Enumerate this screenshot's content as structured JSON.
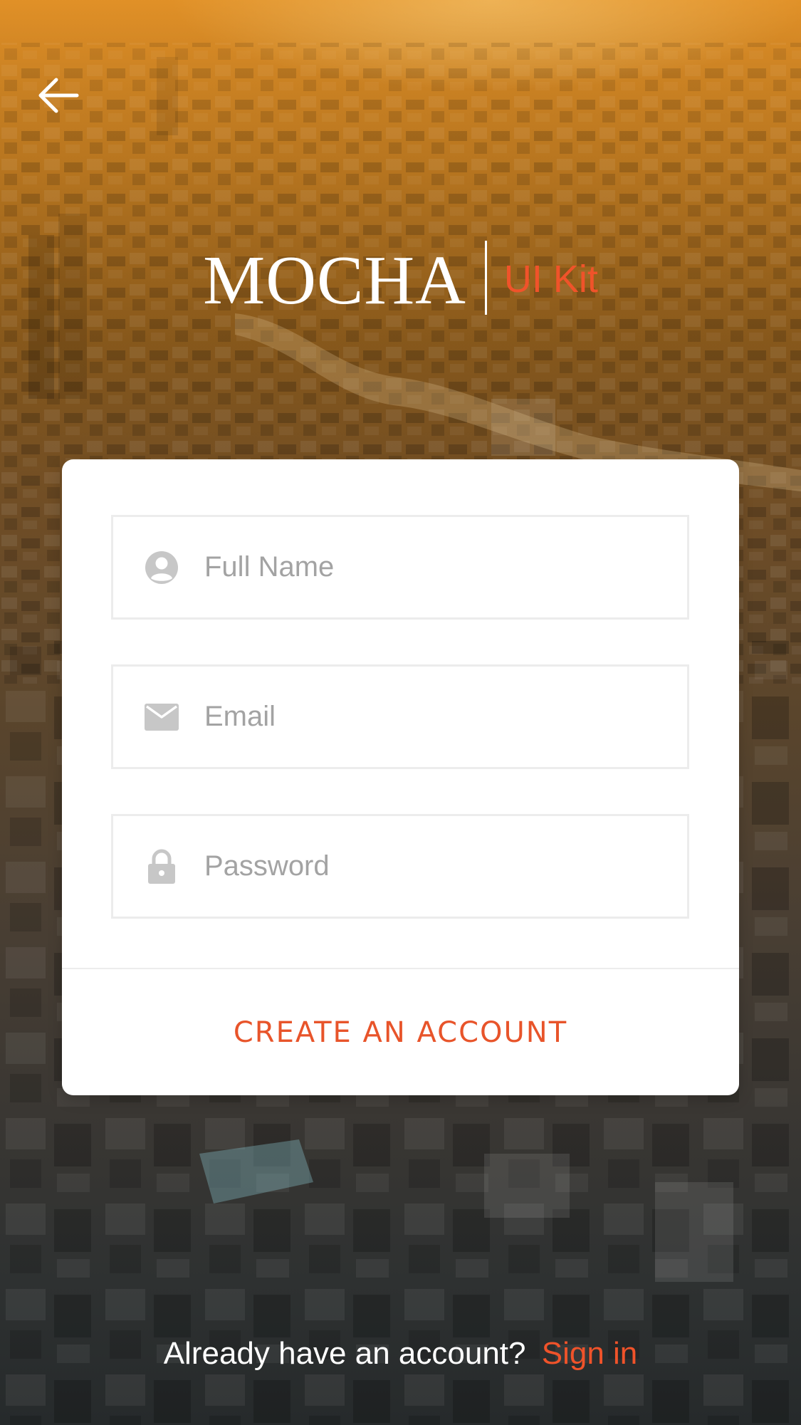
{
  "brand": {
    "name": "MOCHA",
    "subtitle": "UI Kit",
    "accent_color": "#f0532a"
  },
  "nav": {
    "back_icon": "arrow-left-icon"
  },
  "form": {
    "full_name": {
      "placeholder": "Full Name",
      "value": "",
      "icon": "user-icon"
    },
    "email": {
      "placeholder": "Email",
      "value": "",
      "icon": "mail-icon"
    },
    "password": {
      "placeholder": "Password",
      "value": "",
      "icon": "lock-icon"
    },
    "submit_label": "CREATE AN ACCOUNT"
  },
  "footer": {
    "prompt": "Already have an account?",
    "link_label": "Sign in"
  }
}
